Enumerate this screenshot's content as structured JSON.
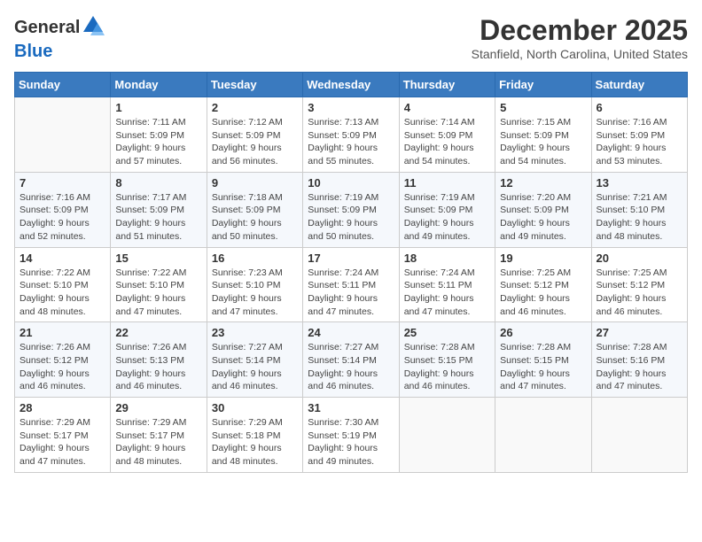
{
  "header": {
    "logo_line1": "General",
    "logo_line2": "Blue",
    "month_title": "December 2025",
    "location": "Stanfield, North Carolina, United States"
  },
  "weekdays": [
    "Sunday",
    "Monday",
    "Tuesday",
    "Wednesday",
    "Thursday",
    "Friday",
    "Saturday"
  ],
  "weeks": [
    [
      {
        "day": "",
        "info": ""
      },
      {
        "day": "1",
        "info": "Sunrise: 7:11 AM\nSunset: 5:09 PM\nDaylight: 9 hours\nand 57 minutes."
      },
      {
        "day": "2",
        "info": "Sunrise: 7:12 AM\nSunset: 5:09 PM\nDaylight: 9 hours\nand 56 minutes."
      },
      {
        "day": "3",
        "info": "Sunrise: 7:13 AM\nSunset: 5:09 PM\nDaylight: 9 hours\nand 55 minutes."
      },
      {
        "day": "4",
        "info": "Sunrise: 7:14 AM\nSunset: 5:09 PM\nDaylight: 9 hours\nand 54 minutes."
      },
      {
        "day": "5",
        "info": "Sunrise: 7:15 AM\nSunset: 5:09 PM\nDaylight: 9 hours\nand 54 minutes."
      },
      {
        "day": "6",
        "info": "Sunrise: 7:16 AM\nSunset: 5:09 PM\nDaylight: 9 hours\nand 53 minutes."
      }
    ],
    [
      {
        "day": "7",
        "info": "Sunrise: 7:16 AM\nSunset: 5:09 PM\nDaylight: 9 hours\nand 52 minutes."
      },
      {
        "day": "8",
        "info": "Sunrise: 7:17 AM\nSunset: 5:09 PM\nDaylight: 9 hours\nand 51 minutes."
      },
      {
        "day": "9",
        "info": "Sunrise: 7:18 AM\nSunset: 5:09 PM\nDaylight: 9 hours\nand 50 minutes."
      },
      {
        "day": "10",
        "info": "Sunrise: 7:19 AM\nSunset: 5:09 PM\nDaylight: 9 hours\nand 50 minutes."
      },
      {
        "day": "11",
        "info": "Sunrise: 7:19 AM\nSunset: 5:09 PM\nDaylight: 9 hours\nand 49 minutes."
      },
      {
        "day": "12",
        "info": "Sunrise: 7:20 AM\nSunset: 5:09 PM\nDaylight: 9 hours\nand 49 minutes."
      },
      {
        "day": "13",
        "info": "Sunrise: 7:21 AM\nSunset: 5:10 PM\nDaylight: 9 hours\nand 48 minutes."
      }
    ],
    [
      {
        "day": "14",
        "info": "Sunrise: 7:22 AM\nSunset: 5:10 PM\nDaylight: 9 hours\nand 48 minutes."
      },
      {
        "day": "15",
        "info": "Sunrise: 7:22 AM\nSunset: 5:10 PM\nDaylight: 9 hours\nand 47 minutes."
      },
      {
        "day": "16",
        "info": "Sunrise: 7:23 AM\nSunset: 5:10 PM\nDaylight: 9 hours\nand 47 minutes."
      },
      {
        "day": "17",
        "info": "Sunrise: 7:24 AM\nSunset: 5:11 PM\nDaylight: 9 hours\nand 47 minutes."
      },
      {
        "day": "18",
        "info": "Sunrise: 7:24 AM\nSunset: 5:11 PM\nDaylight: 9 hours\nand 47 minutes."
      },
      {
        "day": "19",
        "info": "Sunrise: 7:25 AM\nSunset: 5:12 PM\nDaylight: 9 hours\nand 46 minutes."
      },
      {
        "day": "20",
        "info": "Sunrise: 7:25 AM\nSunset: 5:12 PM\nDaylight: 9 hours\nand 46 minutes."
      }
    ],
    [
      {
        "day": "21",
        "info": "Sunrise: 7:26 AM\nSunset: 5:12 PM\nDaylight: 9 hours\nand 46 minutes."
      },
      {
        "day": "22",
        "info": "Sunrise: 7:26 AM\nSunset: 5:13 PM\nDaylight: 9 hours\nand 46 minutes."
      },
      {
        "day": "23",
        "info": "Sunrise: 7:27 AM\nSunset: 5:14 PM\nDaylight: 9 hours\nand 46 minutes."
      },
      {
        "day": "24",
        "info": "Sunrise: 7:27 AM\nSunset: 5:14 PM\nDaylight: 9 hours\nand 46 minutes."
      },
      {
        "day": "25",
        "info": "Sunrise: 7:28 AM\nSunset: 5:15 PM\nDaylight: 9 hours\nand 46 minutes."
      },
      {
        "day": "26",
        "info": "Sunrise: 7:28 AM\nSunset: 5:15 PM\nDaylight: 9 hours\nand 47 minutes."
      },
      {
        "day": "27",
        "info": "Sunrise: 7:28 AM\nSunset: 5:16 PM\nDaylight: 9 hours\nand 47 minutes."
      }
    ],
    [
      {
        "day": "28",
        "info": "Sunrise: 7:29 AM\nSunset: 5:17 PM\nDaylight: 9 hours\nand 47 minutes."
      },
      {
        "day": "29",
        "info": "Sunrise: 7:29 AM\nSunset: 5:17 PM\nDaylight: 9 hours\nand 48 minutes."
      },
      {
        "day": "30",
        "info": "Sunrise: 7:29 AM\nSunset: 5:18 PM\nDaylight: 9 hours\nand 48 minutes."
      },
      {
        "day": "31",
        "info": "Sunrise: 7:30 AM\nSunset: 5:19 PM\nDaylight: 9 hours\nand 49 minutes."
      },
      {
        "day": "",
        "info": ""
      },
      {
        "day": "",
        "info": ""
      },
      {
        "day": "",
        "info": ""
      }
    ]
  ]
}
